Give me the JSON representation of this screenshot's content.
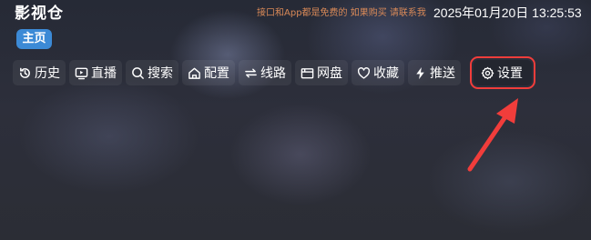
{
  "header": {
    "app_title": "影视仓",
    "notice": "接口和App都是免费的 如果购买 请联系我",
    "datetime": "2025年01月20日 13:25:53"
  },
  "tabs": {
    "home_label": "主页"
  },
  "nav": {
    "items": [
      {
        "label": "历史",
        "icon": "history-icon"
      },
      {
        "label": "直播",
        "icon": "live-tv-icon"
      },
      {
        "label": "搜索",
        "icon": "search-icon"
      },
      {
        "label": "配置",
        "icon": "home-config-icon"
      },
      {
        "label": "线路",
        "icon": "route-switch-icon"
      },
      {
        "label": "网盘",
        "icon": "cloud-drive-icon"
      },
      {
        "label": "收藏",
        "icon": "heart-icon"
      },
      {
        "label": "推送",
        "icon": "lightning-icon"
      },
      {
        "label": "设置",
        "icon": "gear-icon"
      }
    ]
  },
  "colors": {
    "accent_tab": "#3c8ad6",
    "notice_text": "#e8915a",
    "annotation": "#f13d3b"
  }
}
